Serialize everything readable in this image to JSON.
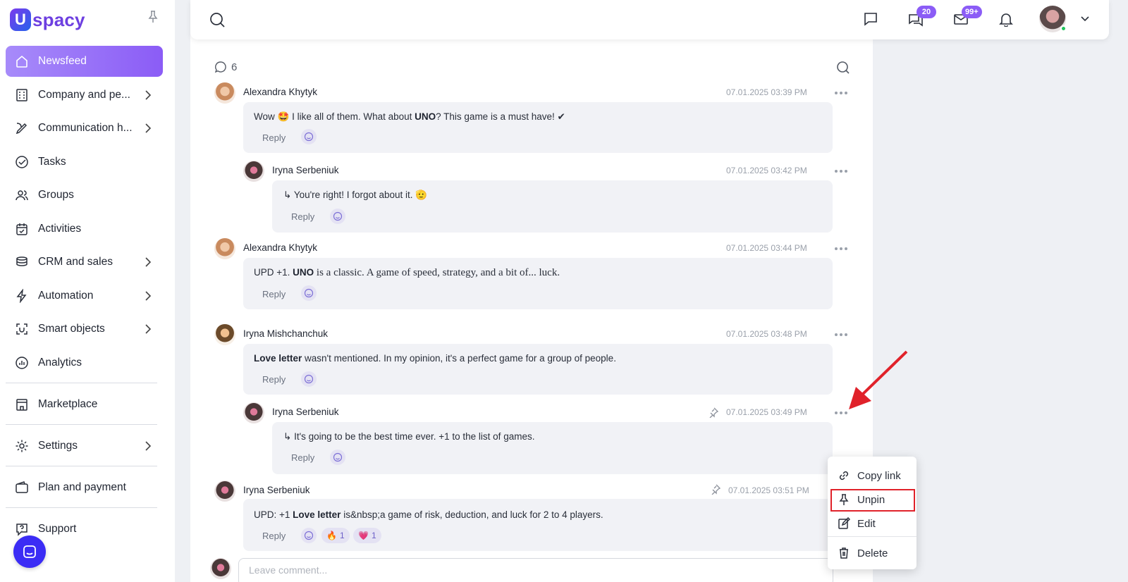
{
  "brand": {
    "logo_letter": "U",
    "logo_text": "spacy"
  },
  "sidebar": {
    "items": [
      {
        "label": "Newsfeed",
        "icon": "home-icon",
        "active": true,
        "chevron": false
      },
      {
        "label": "Company and pe...",
        "icon": "building-icon",
        "chevron": true
      },
      {
        "label": "Communication h...",
        "icon": "communication-icon",
        "chevron": true
      },
      {
        "label": "Tasks",
        "icon": "check-circle-icon",
        "chevron": false
      },
      {
        "label": "Groups",
        "icon": "users-icon",
        "chevron": false
      },
      {
        "label": "Activities",
        "icon": "calendar-icon",
        "chevron": false
      },
      {
        "label": "CRM and sales",
        "icon": "stack-icon",
        "chevron": true
      },
      {
        "label": "Automation",
        "icon": "bolt-icon",
        "chevron": true
      },
      {
        "label": "Smart objects",
        "icon": "smart-object-icon",
        "chevron": true
      },
      {
        "label": "Analytics",
        "icon": "analytics-icon",
        "chevron": false
      },
      {
        "label": "Marketplace",
        "icon": "store-icon",
        "chevron": false
      },
      {
        "label": "Settings",
        "icon": "gear-icon",
        "chevron": true
      },
      {
        "label": "Plan and payment",
        "icon": "wallet-icon",
        "chevron": false
      },
      {
        "label": "Support",
        "icon": "help-icon",
        "chevron": false
      }
    ]
  },
  "topbar": {
    "chats_badge": "20",
    "mail_badge": "99+"
  },
  "comments": {
    "count": "6",
    "list": [
      {
        "author": "Alexandra Khytyk",
        "time": "07.01.2025 03:39 PM",
        "text_pre": "Wow 🤩 I like all of them. What about ",
        "text_bold": "UNO",
        "text_post": "? This game is a must have! ✔",
        "reply": "Reply"
      },
      {
        "author": "Iryna Serbeniuk",
        "time": "07.01.2025 03:42 PM",
        "text": "You're right! I forgot about it. 🫡",
        "reply": "Reply"
      },
      {
        "author": "Alexandra Khytyk",
        "time": "07.01.2025 03:44 PM",
        "text_pre": "UPD +1. ",
        "text_bold": "UNO",
        "text_post": " is a classic. A game of speed, strategy, and a bit of... luck.",
        "reply": "Reply"
      },
      {
        "author": "Iryna Mishchanchuk",
        "time": "07.01.2025 03:48 PM",
        "text_bold": "Love letter",
        "text_post": " wasn't mentioned. In my opinion, it's a perfect game for a group of people.",
        "reply": "Reply"
      },
      {
        "author": "Iryna Serbeniuk",
        "time": "07.01.2025 03:49 PM",
        "text": "It's going to be the best time ever. +1 to the list of games.",
        "reply": "Reply"
      },
      {
        "author": "Iryna Serbeniuk",
        "time": "07.01.2025 03:51 PM",
        "text_pre": "UPD: +1 ",
        "text_bold": "Love letter",
        "text_post": " is&nbsp;a game of risk, deduction, and luck for 2 to 4 players.",
        "reply": "Reply",
        "reactions": [
          {
            "emoji": "🔥",
            "count": "1"
          },
          {
            "emoji": "💗",
            "count": "1"
          }
        ]
      }
    ],
    "leave_placeholder": "Leave comment..."
  },
  "context_menu": {
    "items": [
      {
        "label": "Copy link",
        "icon": "link-icon"
      },
      {
        "label": "Unpin",
        "icon": "pin-icon"
      },
      {
        "label": "Edit",
        "icon": "edit-icon"
      },
      {
        "label": "Delete",
        "icon": "trash-icon"
      }
    ]
  },
  "colors": {
    "accent": "#8b5cf6",
    "highlight": "#e0222a"
  }
}
